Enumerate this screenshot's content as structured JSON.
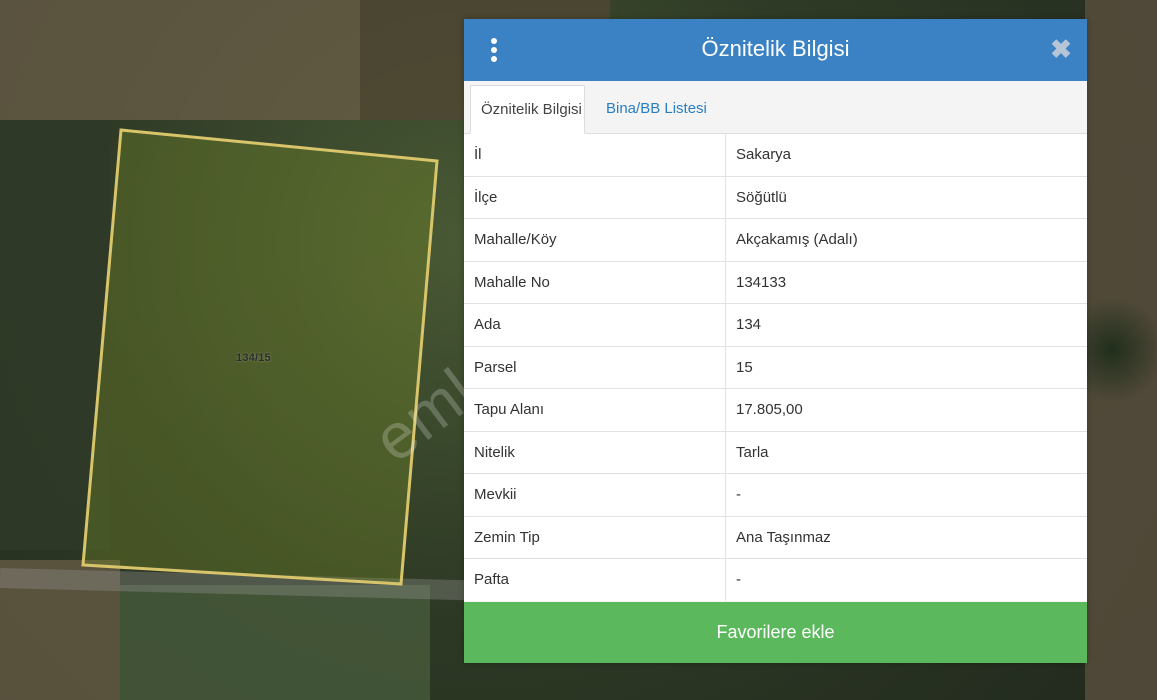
{
  "map": {
    "parcel_label": "134/15",
    "watermark": "emlakjet.com",
    "parcel_outline_color": "#d8c46a"
  },
  "panel": {
    "title": "Öznitelik Bilgisi",
    "menu_icon": "vertical-dots-icon",
    "close_icon": "close-icon",
    "header_color": "#3a82c4",
    "tabs": [
      {
        "label": "Öznitelik Bilgisi",
        "active": true
      },
      {
        "label": "Bina/BB Listesi",
        "active": false
      }
    ],
    "rows": [
      {
        "key": "İl",
        "value": "Sakarya"
      },
      {
        "key": "İlçe",
        "value": "Söğütlü"
      },
      {
        "key": "Mahalle/Köy",
        "value": "Akçakamış (Adalı)"
      },
      {
        "key": "Mahalle No",
        "value": "134133"
      },
      {
        "key": "Ada",
        "value": "134"
      },
      {
        "key": "Parsel",
        "value": "15"
      },
      {
        "key": "Tapu Alanı",
        "value": "17.805,00"
      },
      {
        "key": "Nitelik",
        "value": "Tarla"
      },
      {
        "key": "Mevkii",
        "value": "-"
      },
      {
        "key": "Zemin Tip",
        "value": "Ana Taşınmaz"
      },
      {
        "key": "Pafta",
        "value": "-"
      }
    ],
    "favorite_button": "Favorilere ekle",
    "favorite_color": "#5cb85c"
  }
}
